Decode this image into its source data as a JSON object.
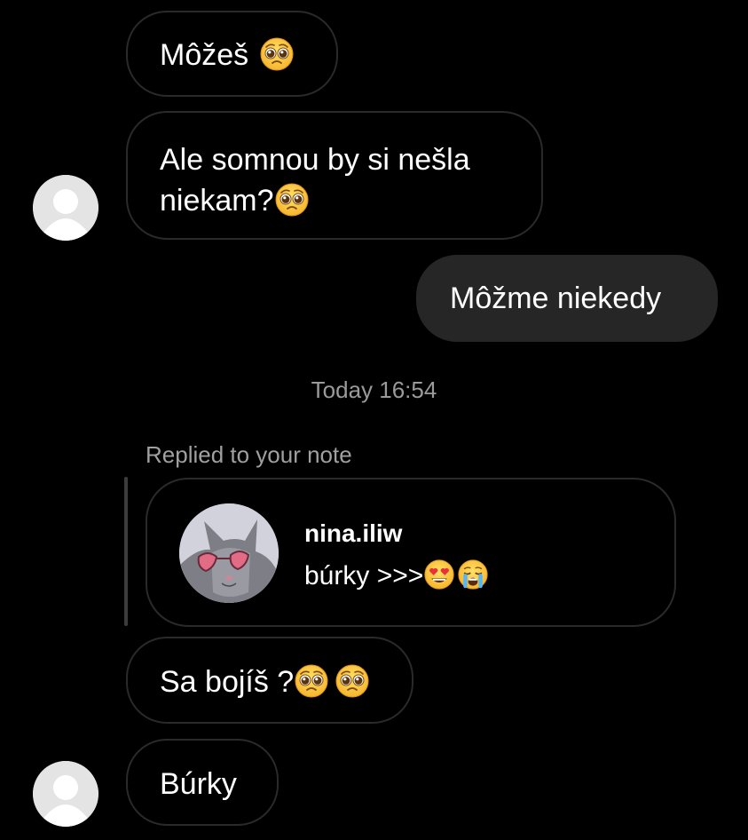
{
  "conversation": {
    "messages": [
      {
        "text": "Môžeš",
        "emoji": "pleading-face"
      },
      {
        "line1": "Ale somnou by si nešla",
        "line2": "niekam?",
        "emoji": "pleading-face"
      },
      {
        "text": "Môžme niekedy"
      },
      {
        "text": "Sa bojíš ?",
        "emoji": "pleading-face pleading-face"
      },
      {
        "text": "Búrky"
      }
    ],
    "timestamp": "Today 16:54",
    "reply_label": "Replied to your note",
    "note": {
      "username": "nina.iliw",
      "text": "búrky >>>",
      "emojis": [
        "heart-eyes-face",
        "loudly-crying-face"
      ]
    }
  },
  "colors": {
    "background": "#000000",
    "incoming_border": "#2a2a2a",
    "outgoing_bubble": "#262626",
    "secondary_text": "#9a9a9a",
    "emoji_yellow": "#ffc83d"
  }
}
